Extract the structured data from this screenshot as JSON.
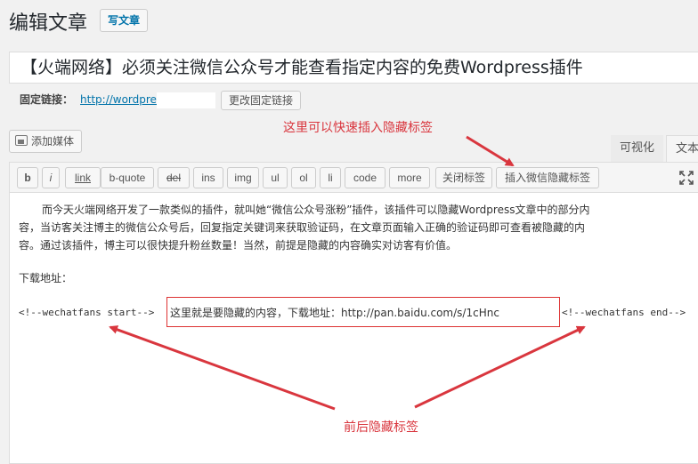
{
  "header": {
    "title": "编辑文章",
    "add_new_label": "写文章"
  },
  "post": {
    "title": "【火端网络】必须关注微信公众号才能查看指定内容的免费Wordpress插件"
  },
  "permalink": {
    "label": "固定链接：",
    "url_visible": "http://wordpre",
    "edit_button": "更改固定链接"
  },
  "media": {
    "add_media_label": "添加媒体"
  },
  "tabs": {
    "visual": "可视化",
    "text": "文本"
  },
  "toolbar": {
    "buttons": [
      "b",
      "i",
      "link",
      "b-quote",
      "del",
      "ins",
      "img",
      "ul",
      "ol",
      "li",
      "code",
      "more",
      "关闭标签",
      "插入微信隐藏标签"
    ]
  },
  "content": {
    "paragraph_lines": [
      "而今天火端网络开发了一款类似的插件，就叫她“微信公众号涨粉”插件，该插件可以隐藏Wordpress文章中的部分内",
      "容，当访客关注博主的微信公众号后，回复指定关键词来获取验证码，在文章页面输入正确的验证码即可查看被隐藏的内",
      "容。通过该插件，博主可以很快提升粉丝数量！当然，前提是隐藏的内容确实对访客有价值。"
    ],
    "download_label": "下载地址：",
    "tag_start": "<!--wechatfans start-->",
    "hidden_content": "这里就是要隐藏的内容，下载地址：http://pan.baidu.com/s/1cHnc",
    "tag_end": "<!--wechatfans end-->"
  },
  "annotations": {
    "top_note": "这里可以快速插入隐藏标签",
    "bottom_note": "前后隐藏标签",
    "color": "#d9363e"
  },
  "icons": {
    "media": "media-icon",
    "fullscreen": "fullscreen-icon"
  }
}
